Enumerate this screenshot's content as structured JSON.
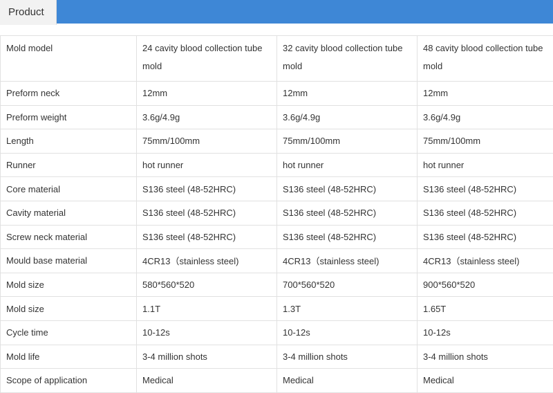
{
  "header": {
    "tab_label": "Product",
    "accent_color": "#3e87d6"
  },
  "table": {
    "rows": [
      {
        "label": "Mold model",
        "values": [
          "24 cavity blood collection tube mold",
          "32 cavity blood collection tube mold",
          "48 cavity blood collection tube mold"
        ]
      },
      {
        "label": "Preform neck",
        "values": [
          "12mm",
          "12mm",
          "12mm"
        ]
      },
      {
        "label": "Preform weight",
        "values": [
          "3.6g/4.9g",
          "3.6g/4.9g",
          "3.6g/4.9g"
        ]
      },
      {
        "label": "Length",
        "values": [
          "75mm/100mm",
          "75mm/100mm",
          "75mm/100mm"
        ]
      },
      {
        "label": "Runner",
        "values": [
          "hot runner",
          "hot runner",
          "hot runner"
        ]
      },
      {
        "label": "Core material",
        "values": [
          "S136 steel (48-52HRC)",
          "S136 steel (48-52HRC)",
          "S136 steel (48-52HRC)"
        ]
      },
      {
        "label": "Cavity material",
        "values": [
          "S136 steel (48-52HRC)",
          "S136 steel (48-52HRC)",
          "S136 steel (48-52HRC)"
        ]
      },
      {
        "label": "Screw neck material",
        "values": [
          "S136 steel (48-52HRC)",
          "S136 steel (48-52HRC)",
          "S136 steel (48-52HRC)"
        ]
      },
      {
        "label": "Mould base material",
        "values": [
          " 4CR13（stainless steel)",
          " 4CR13（stainless steel)",
          " 4CR13（stainless steel)"
        ]
      },
      {
        "label": "Mold size",
        "values": [
          "580*560*520",
          "700*560*520",
          "900*560*520"
        ]
      },
      {
        "label": "Mold size",
        "values": [
          "1.1T",
          "1.3T",
          "1.65T"
        ]
      },
      {
        "label": "Cycle time",
        "values": [
          "10-12s",
          "10-12s",
          "10-12s"
        ]
      },
      {
        "label": "Mold life",
        "values": [
          "3-4 million shots",
          "3-4 million shots",
          "3-4 million shots"
        ]
      },
      {
        "label": "Scope of application",
        "values": [
          "Medical",
          "Medical",
          "Medical"
        ]
      }
    ]
  }
}
